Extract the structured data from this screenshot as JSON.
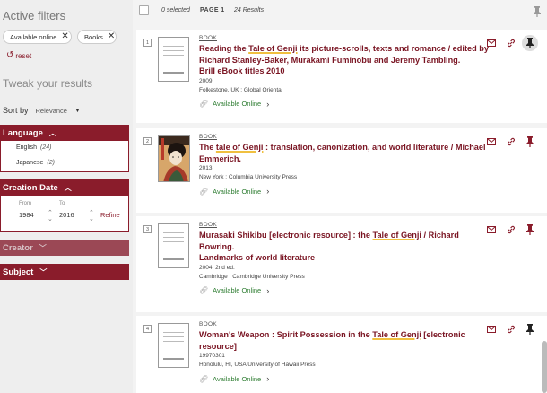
{
  "sidebar": {
    "active_filters_heading": "Active filters",
    "filters": [
      {
        "label": "Available online"
      },
      {
        "label": "Books"
      }
    ],
    "reset_label": "reset",
    "tweak_heading": "Tweak your results",
    "sort_label": "Sort by",
    "sort_value": "Relevance",
    "facets": {
      "language": {
        "label": "Language",
        "options": [
          {
            "label": "English",
            "count": "(24)"
          },
          {
            "label": "Japanese",
            "count": "(2)"
          }
        ]
      },
      "creation_date": {
        "label": "Creation Date",
        "from_label": "From",
        "from_value": "1984",
        "to_label": "To",
        "to_value": "2016",
        "refine_label": "Refine"
      },
      "creator": {
        "label": "Creator"
      },
      "subject": {
        "label": "Subject"
      }
    }
  },
  "toolbar": {
    "selected": "0 selected",
    "page": "PAGE 1",
    "count": "24 Results"
  },
  "results": [
    {
      "index": "1",
      "type": "BOOK",
      "title_parts": [
        "Reading the ",
        "Tale of Genji",
        " its picture-scrolls, texts and romance / edited by Richard Stanley-Baker, Murakami Fuminobu and Jeremy Tambling."
      ],
      "series": "Brill eBook titles 2010",
      "meta": [
        "2009",
        "Folkestone, UK : Global Oriental"
      ],
      "availability": "Available Online",
      "pinned": true
    },
    {
      "index": "2",
      "type": "BOOK",
      "title_parts": [
        "The ",
        "tale of Genji",
        " : translation, canonization, and world literature / Michael Emmerich."
      ],
      "series": "",
      "meta": [
        "2013",
        "New York : Columbia University Press"
      ],
      "availability": "Available Online",
      "pinned": false
    },
    {
      "index": "3",
      "type": "BOOK",
      "title_parts": [
        "Murasaki Shikibu [electronic resource] : the ",
        "Tale of Genji",
        " / Richard Bowring."
      ],
      "series": "Landmarks of world literature",
      "meta": [
        "2004, 2nd ed.",
        "Cambridge : Cambridge University Press"
      ],
      "availability": "Available Online",
      "pinned": false
    },
    {
      "index": "4",
      "type": "BOOK",
      "title_parts": [
        "Woman's Weapon : Spirit Possession in the ",
        "Tale of Genji",
        " [electronic resource]"
      ],
      "series": "",
      "meta": [
        "19970301",
        "Honolulu, HI, USA University of Hawaii Press"
      ],
      "availability": "Available Online",
      "pinned": false
    }
  ],
  "icons": {
    "email": "envelope-icon",
    "link": "permalink-icon",
    "pin": "pushpin-icon"
  },
  "colors": {
    "accent": "#8a1c2b",
    "title": "#7a1523",
    "available": "#2e7d32",
    "highlight": "#f0c040"
  }
}
